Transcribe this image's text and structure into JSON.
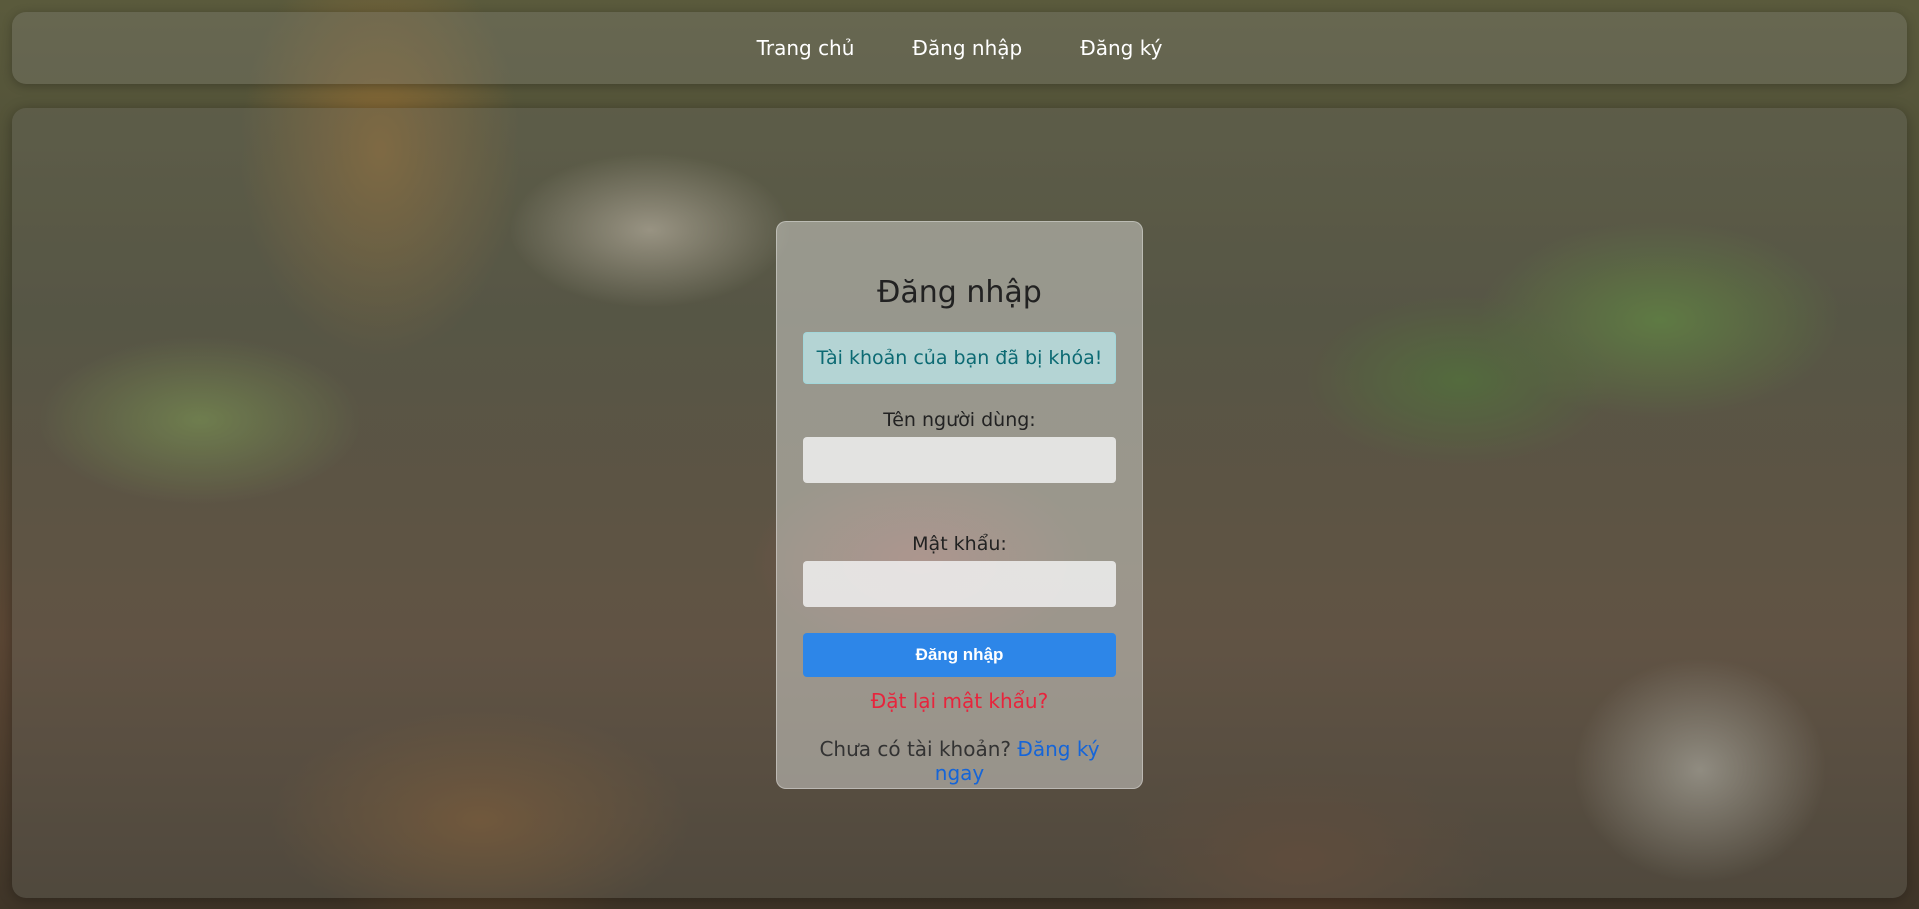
{
  "nav": {
    "home": "Trang chủ",
    "login": "Đăng nhập",
    "register": "Đăng ký"
  },
  "login_card": {
    "title": "Đăng nhập",
    "alert": "Tài khoản của bạn đã bị khóa!",
    "username_label": "Tên người dùng:",
    "username_value": "",
    "password_label": "Mật khẩu:",
    "password_value": "",
    "submit_label": "Đăng nhập",
    "reset_link": "Đặt lại mật khẩu?",
    "signup_prompt": "Chưa có tài khoản?",
    "signup_link": "Đăng ký ngay"
  },
  "colors": {
    "button": "#2d86e8",
    "reset_link": "#e8243c",
    "signup_link": "#1565d8",
    "alert_text": "#0c6a73"
  }
}
